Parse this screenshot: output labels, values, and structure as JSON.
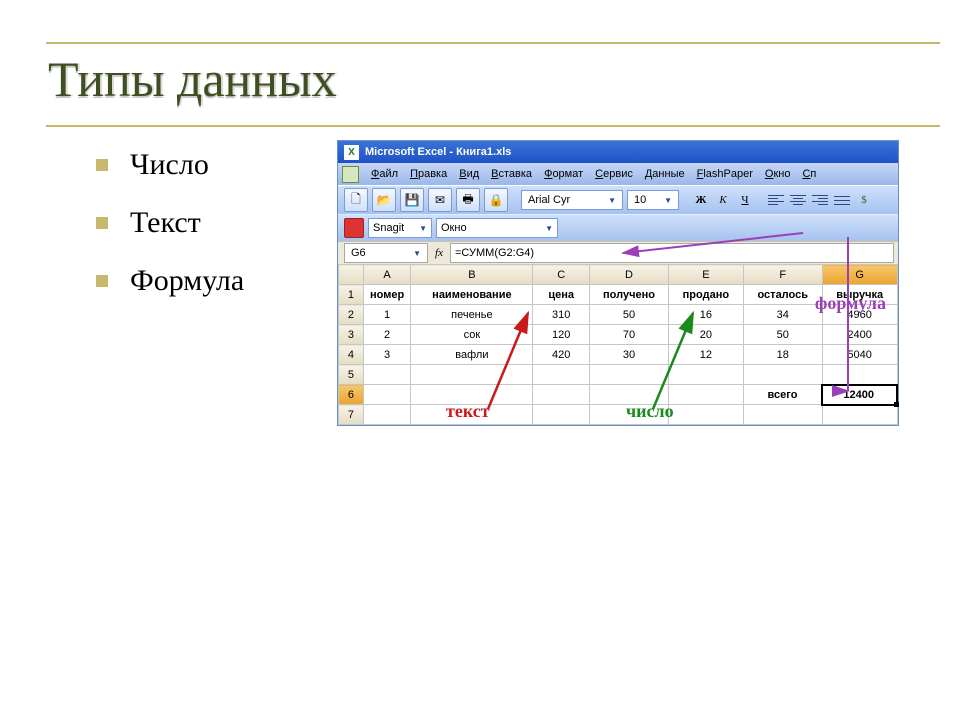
{
  "slide": {
    "title": "Типы данных",
    "bullets": [
      "Число",
      "Текст",
      "Формула"
    ]
  },
  "excel": {
    "title": "Microsoft Excel - Книга1.xls",
    "menu": [
      "Файл",
      "Правка",
      "Вид",
      "Вставка",
      "Формат",
      "Сервис",
      "Данные",
      "FlashPaper",
      "Окно",
      "Сп"
    ],
    "font": "Arial Cyr",
    "font_size": "10",
    "snagit": "Snagit",
    "window_combo": "Окно",
    "namebox": "G6",
    "fx": "fx",
    "formula": "=СУММ(G2:G4)",
    "columns": [
      "A",
      "B",
      "C",
      "D",
      "E",
      "F",
      "G"
    ],
    "headers": [
      "номер",
      "наименование",
      "цена",
      "получено",
      "продано",
      "осталось",
      "выручка"
    ],
    "rows": [
      {
        "n": "1",
        "name": "печенье",
        "price": "310",
        "got": "50",
        "sold": "16",
        "left": "34",
        "rev": "4960"
      },
      {
        "n": "2",
        "name": "сок",
        "price": "120",
        "got": "70",
        "sold": "20",
        "left": "50",
        "rev": "2400"
      },
      {
        "n": "3",
        "name": "вафли",
        "price": "420",
        "got": "30",
        "sold": "12",
        "left": "18",
        "rev": "5040"
      }
    ],
    "total_label": "всего",
    "total_value": "12400",
    "annotations": {
      "formula": "формула",
      "text": "текст",
      "number": "число"
    }
  },
  "chart_data": {
    "type": "table",
    "columns": [
      "номер",
      "наименование",
      "цена",
      "получено",
      "продано",
      "осталось",
      "выручка"
    ],
    "rows": [
      [
        1,
        "печенье",
        310,
        50,
        16,
        34,
        4960
      ],
      [
        2,
        "сок",
        120,
        70,
        20,
        50,
        2400
      ],
      [
        3,
        "вафли",
        420,
        30,
        12,
        18,
        5040
      ]
    ],
    "totals": {
      "выручка": 12400
    }
  }
}
